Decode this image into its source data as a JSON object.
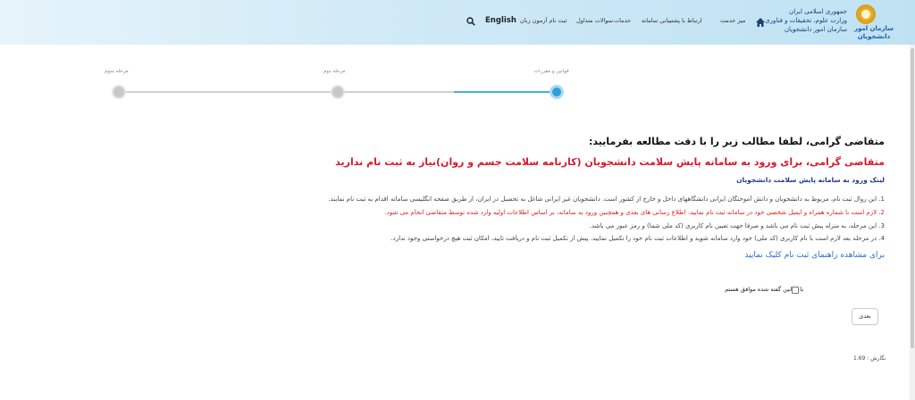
{
  "header": {
    "logo_text": "سازمان امور دانشجویان",
    "ministry_lines": [
      "جمهوری اسلامی ایران",
      "وزارت علوم، تحقیقات و فناوری",
      "سازمان امور دانشجویان"
    ],
    "nav": [
      "میز خدمت",
      "ارتباط با پشتیبانی سامانه",
      "خدمات",
      "سوالات متداول",
      "ثبت نام آزمون زبان"
    ],
    "english_label": "English",
    "colors": {
      "accent": "#2f9fd3",
      "header_bg": "#cfe9f6"
    }
  },
  "steps": [
    {
      "label": "قوانین و مقررات",
      "active": true
    },
    {
      "label": "مرحله دوم",
      "active": false
    },
    {
      "label": "مرحله سوم",
      "active": false
    }
  ],
  "content": {
    "instruction_title": "متقاضی گرامی، لطفا مطالب زیر را با دقت مطالعه بفرمایید:",
    "red_title": "متقاضی گرامی، برای ورود به سامانه پایش سلامت دانشجویان (کارنامه سلامت جسم و روان)نیاز به ثبت نام ندارید",
    "link_title": "لینک ورود به سامانه پایش سلامت دانشجویان",
    "rules": [
      {
        "text": "1. این روال ثبت نام، مربوط به دانشجویان و دانش آموختگان ایرانی دانشگاههای داخل و خارج از کشور است. دانشجویان غیر ایرانی شاغل به تحصیل در ایران، از طریق صفحه انگلیسی سامانه اقدام به ثبت نام نمایند.",
        "red": false
      },
      {
        "text": "2. لازم است با شماره همراه و ایمیل شخصی خود در سامانه ثبت نام نمایید. اطلاع رسانی های بعدی و همچنین ورود به سامانه، بر اساس اطلاعات اولیه وارد شده توسط متقاضی انجام می شود.",
        "red": true
      },
      {
        "text": "3. این مرحله، به منزله پیش ثبت نام می باشد و صرفا جهت تعیین نام کاربری (کد ملی شما) و رمز عبور می باشد.",
        "red": false
      },
      {
        "text": "4. در مرحله بعد لازم است با نام کاربری (کد ملی) خود وارد سامانه شوید و اطلاعات ثبت نام خود را تکمیل نمایید. پیش از تکمیل ثبت نام و دریافت تایید، امکان ثبت هیچ درخواستی وجود ندارد.",
        "red": false
      }
    ],
    "guide_link": "برای مشاهده راهنمای ثبت نام کلیک نمایید",
    "agree_label": "با قوانین گفته شده موافق هستم",
    "next_button": "بعدی",
    "version": "نگارش : 1.69"
  }
}
